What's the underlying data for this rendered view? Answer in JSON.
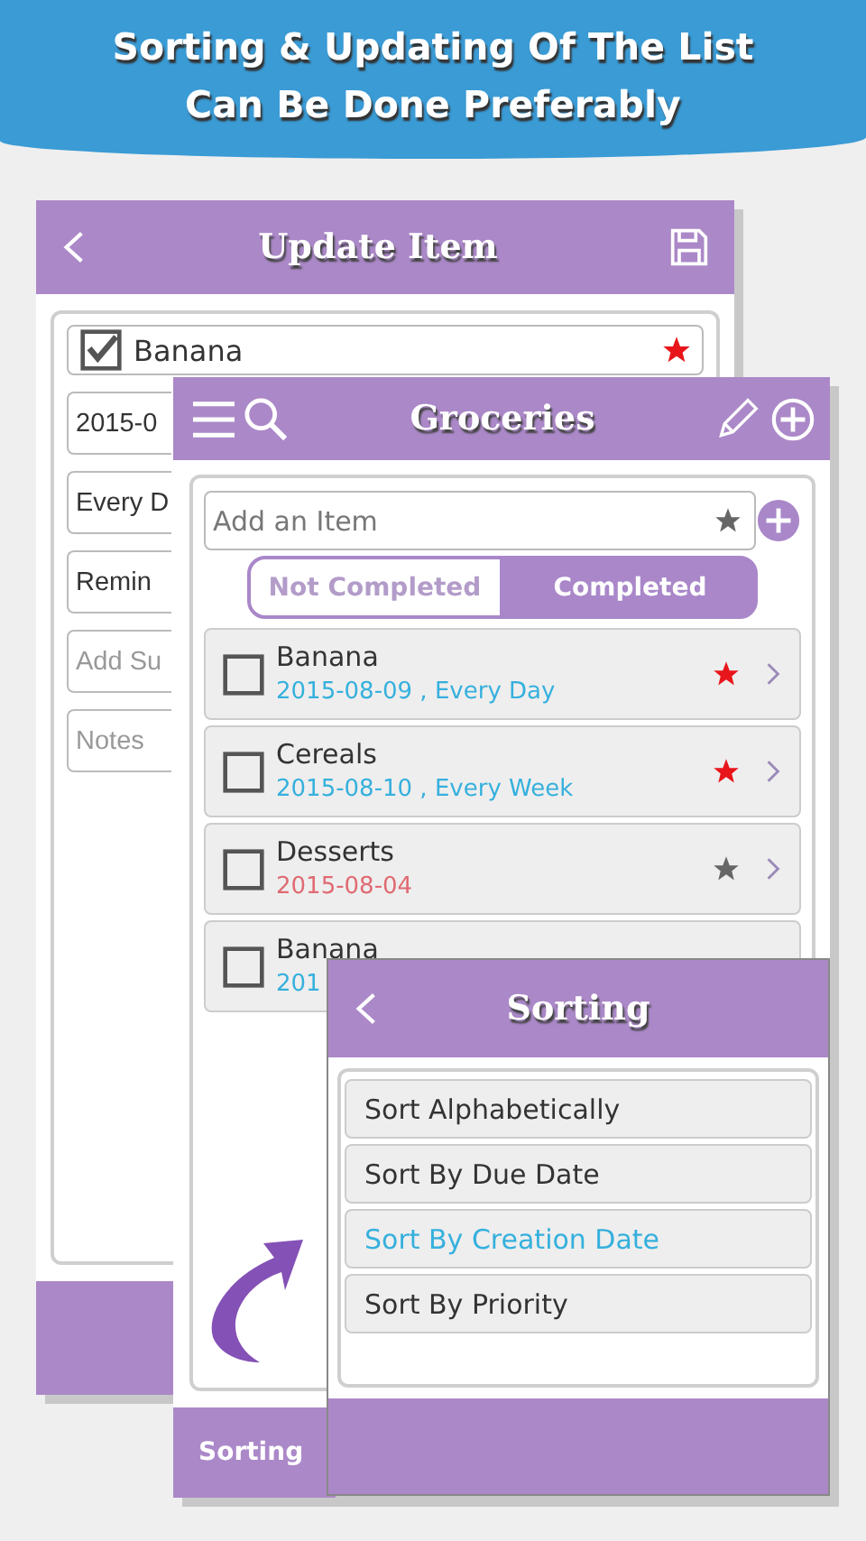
{
  "banner": {
    "lines": [
      "Sorting & Updating Of The List",
      "Can Be Done Preferably"
    ]
  },
  "update_item": {
    "title": "Update Item",
    "fields": [
      {
        "kind": "check",
        "value": "Banana",
        "checked": true,
        "starred": true
      },
      {
        "kind": "text",
        "value": "2015-0"
      },
      {
        "kind": "text",
        "value": "Every D"
      },
      {
        "kind": "text",
        "value": "Remin"
      },
      {
        "kind": "hint",
        "placeholder": "Add Su"
      },
      {
        "kind": "hint",
        "placeholder": "Notes"
      }
    ]
  },
  "groceries": {
    "title": "Groceries",
    "add_field": {
      "placeholder": "Add an Item"
    },
    "tabs": [
      {
        "label": "Not Completed",
        "selected": false
      },
      {
        "label": "Completed",
        "selected": true
      }
    ],
    "items": [
      {
        "name": "Banana",
        "date": "2015-08-09 , Every Day",
        "starred": true,
        "overdue": false,
        "checked": false
      },
      {
        "name": "Cereals",
        "date": "2015-08-10 , Every Week",
        "starred": true,
        "overdue": false,
        "checked": false
      },
      {
        "name": "Desserts",
        "date": "2015-08-04",
        "starred": false,
        "overdue": true,
        "checked": false
      },
      {
        "name": "Banana",
        "date": "201",
        "overdue": false,
        "checked": false
      }
    ],
    "bottom_label": "Sorting"
  },
  "sorting": {
    "title": "Sorting",
    "options": [
      {
        "label": "Sort Alphabetically",
        "selected": false
      },
      {
        "label": "Sort By Due Date",
        "selected": false
      },
      {
        "label": "Sort By Creation Date",
        "selected": true
      },
      {
        "label": "Sort By Priority",
        "selected": false
      }
    ]
  }
}
